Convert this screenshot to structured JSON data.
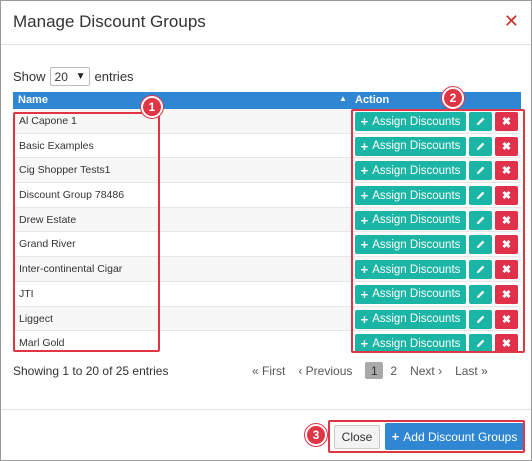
{
  "dialog": {
    "title": "Manage Discount Groups",
    "close_icon": "close-icon"
  },
  "length_control": {
    "show_label": "Show",
    "selected_value": "20",
    "entries_label": "entries"
  },
  "table": {
    "columns": [
      "Name",
      "Action"
    ],
    "sort_icon": "sort-ascending-icon",
    "rows": [
      {
        "name": "Al Capone 1"
      },
      {
        "name": "Basic Examples"
      },
      {
        "name": "Cig Shopper Tests1"
      },
      {
        "name": "Discount Group 78486"
      },
      {
        "name": "Drew Estate"
      },
      {
        "name": "Grand River"
      },
      {
        "name": "Inter-continental Cigar"
      },
      {
        "name": "JTI"
      },
      {
        "name": "Liggect"
      },
      {
        "name": "Marl Gold"
      }
    ],
    "assign_label": "Assign Discounts",
    "edit_icon": "pencil-icon",
    "delete_icon": "delete-x-icon"
  },
  "info_text": "Showing 1 to 20 of 25 entries",
  "pagination": {
    "first": "« First",
    "previous": "‹ Previous",
    "pages": [
      "1",
      "2"
    ],
    "current_page": "1",
    "next": "Next ›",
    "last": "Last »"
  },
  "footer": {
    "close_label": "Close",
    "add_label": "Add Discount Groups"
  },
  "annotations": {
    "badges": [
      "1",
      "2",
      "3"
    ],
    "highlight_color": "#e03545"
  },
  "colors": {
    "header_blue": "#2f87d4",
    "teal": "#1ab5a4",
    "danger": "#e0304a"
  }
}
